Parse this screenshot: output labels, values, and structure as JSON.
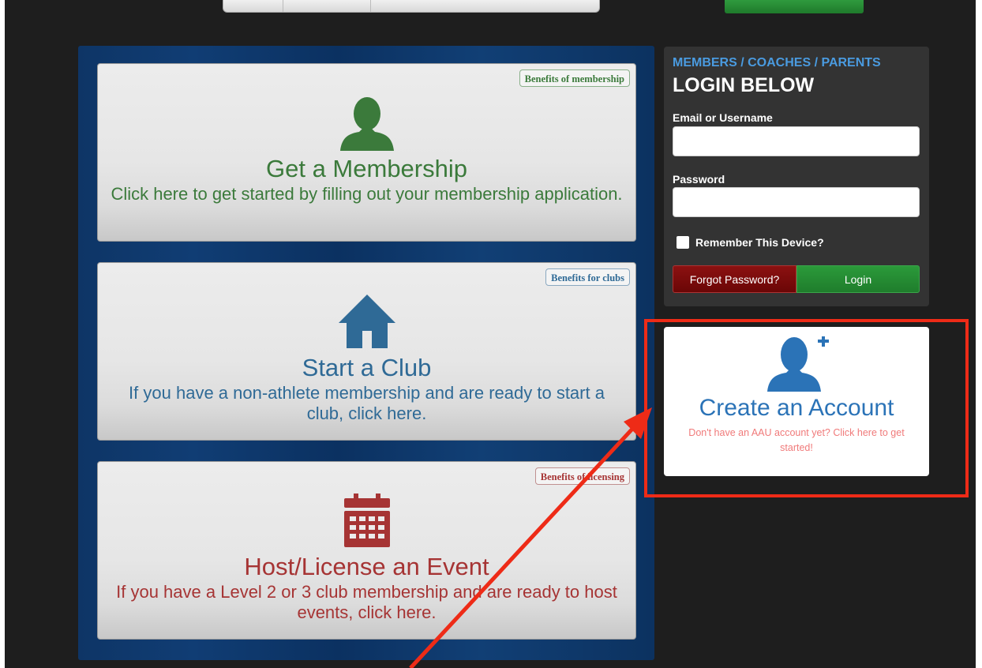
{
  "actions": {
    "membership": {
      "benefit": "Benefits of membership",
      "title": "Get a Membership",
      "description": "Click here to get started by filling out your membership application.",
      "color": "#3b7a3b"
    },
    "club": {
      "benefit": "Benefits for clubs",
      "title": "Start a Club",
      "description": "If you have a non-athlete membership and are ready to start a club, click here.",
      "color": "#2f6a96"
    },
    "event": {
      "benefit": "Benefits of licensing",
      "title": "Host/License an Event",
      "description": "If you have a Level 2 or 3 club membership and are ready to host events, click here.",
      "color": "#a63434"
    }
  },
  "login": {
    "kicker": "MEMBERS / COACHES / PARENTS",
    "heading": "LOGIN BELOW",
    "email_label": "Email or Username",
    "email_value": "",
    "password_label": "Password",
    "password_value": "",
    "remember_label": "Remember This Device?",
    "forgot_label": "Forgot Password?",
    "login_label": "Login"
  },
  "create_account": {
    "title": "Create an Account",
    "subtitle": "Don't have an AAU account yet? Click here to get started!"
  },
  "icons": {
    "membership": "user-icon",
    "club": "home-icon",
    "event": "calendar-icon",
    "create": "user-plus-icon"
  },
  "colors": {
    "annotation": "#ee2b17",
    "panel_blue": "#0e3566",
    "login_green": "#1f7d2c",
    "forgot_red": "#7a0b0b",
    "create_blue": "#2b73b7"
  }
}
